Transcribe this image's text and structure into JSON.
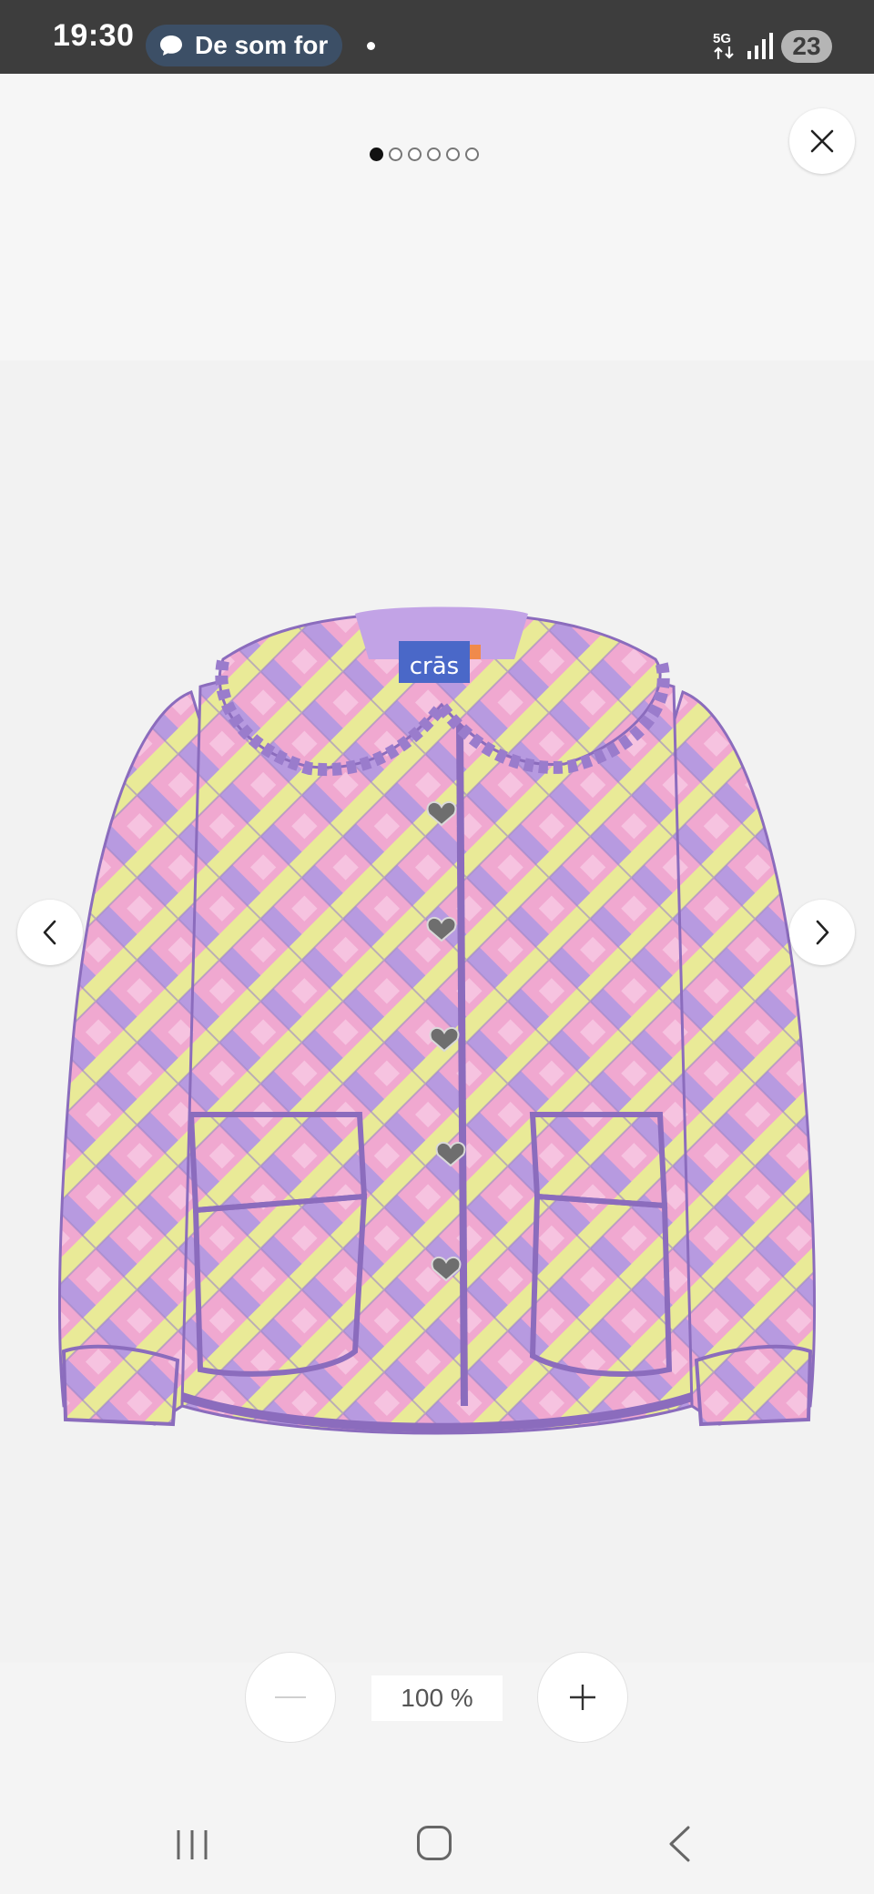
{
  "status_bar": {
    "time": "19:30",
    "notification_text": "De som for",
    "network": "5G",
    "battery": "23"
  },
  "gallery": {
    "image_count": 6,
    "active_index": 0,
    "product_brand": "crās"
  },
  "zoom": {
    "level_label": "100 %"
  },
  "icons": {
    "close": "close-icon",
    "prev": "chevron-left-icon",
    "next": "chevron-right-icon",
    "zoom_out": "minus-icon",
    "zoom_in": "plus-icon"
  }
}
